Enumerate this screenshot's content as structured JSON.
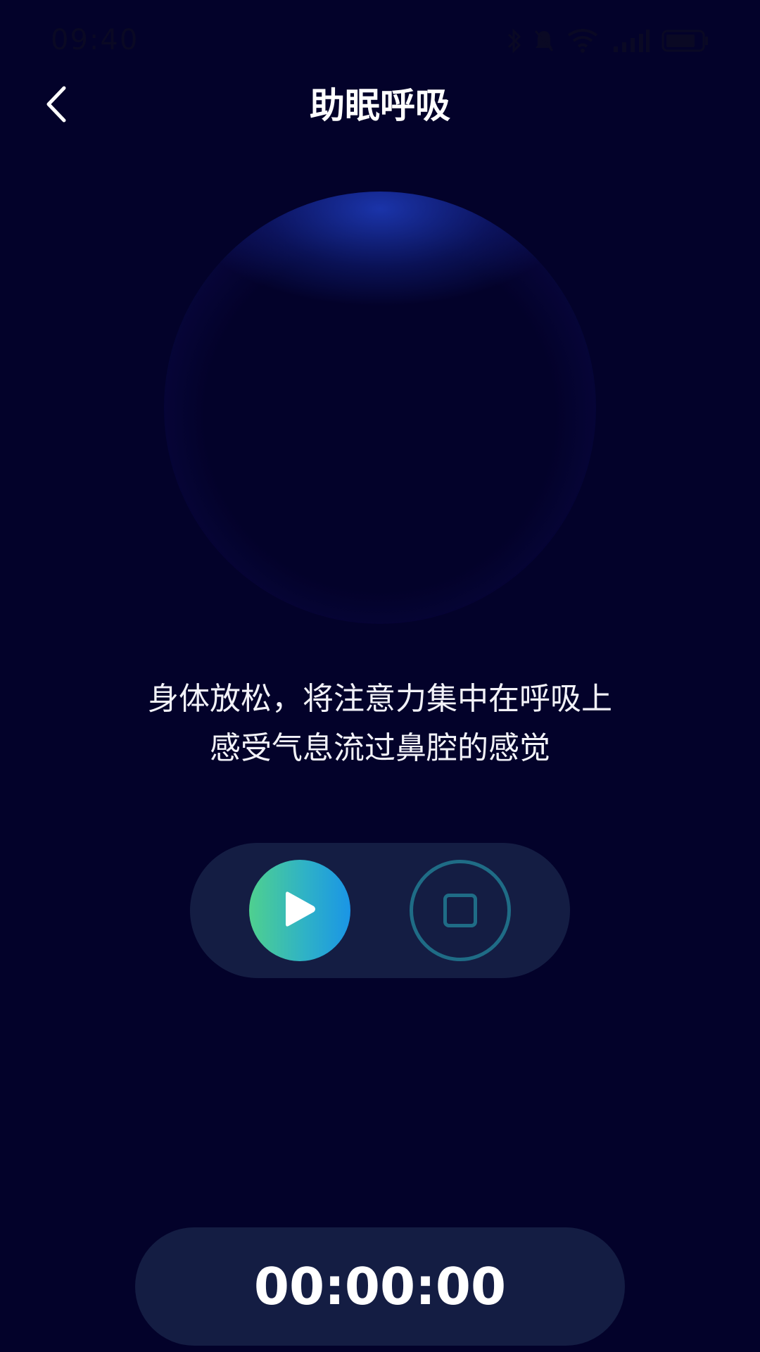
{
  "status_bar": {
    "time": "09:40",
    "icons": [
      "bluetooth-icon",
      "mute-bell-icon",
      "wifi-icon",
      "signal-icon",
      "battery-icon"
    ]
  },
  "header": {
    "title": "助眠呼吸",
    "back_icon": "chevron-left-icon"
  },
  "breathing": {
    "instruction_line1": "身体放松，将注意力集中在呼吸上",
    "instruction_line2": "感受气息流过鼻腔的感觉"
  },
  "controls": {
    "play_icon": "play-icon",
    "stop_icon": "stop-icon"
  },
  "timer": {
    "value": "00:00:00"
  },
  "colors": {
    "background": "#03022a",
    "pill": "#141d43",
    "play_gradient_start": "#4fd08f",
    "play_gradient_end": "#1a95e6",
    "stop_outline": "#1f6c86"
  }
}
